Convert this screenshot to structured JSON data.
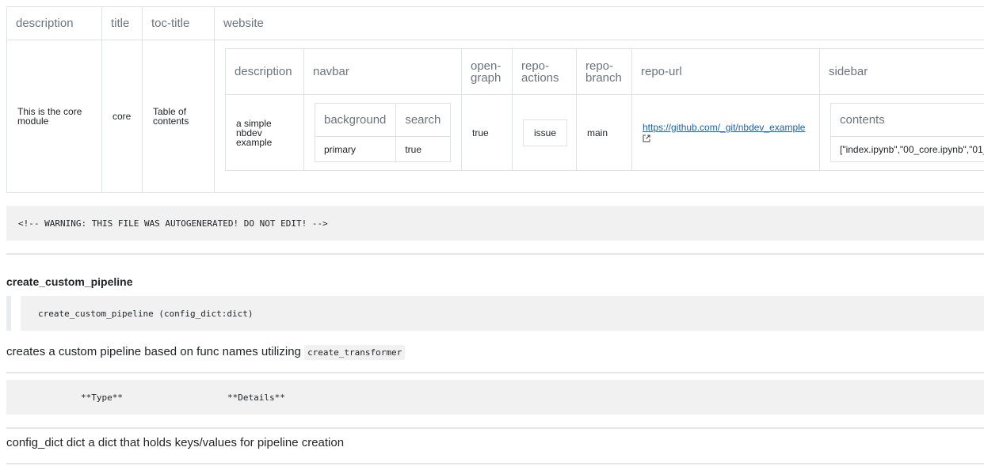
{
  "config_table": {
    "headers": [
      "description",
      "title",
      "toc-title",
      "website"
    ],
    "description": "This is the core module",
    "title": "core",
    "toc_title": "Table of contents",
    "website": {
      "headers": [
        "description",
        "navbar",
        "open-graph",
        "repo-actions",
        "repo-branch",
        "repo-url",
        "sidebar"
      ],
      "description": "a simple nbdev example",
      "navbar": {
        "headers": [
          "background",
          "search"
        ],
        "values": [
          "primary",
          "true"
        ]
      },
      "open_graph": "true",
      "repo_actions": "issue",
      "repo_branch": "main",
      "repo_url": "https://github.com/_git/nbdev_example",
      "sidebar": {
        "header": "contents",
        "value": "[\"index.ipynb\",\"00_core.ipynb\",\"01_"
      }
    }
  },
  "warning_comment": "<!-- WARNING: THIS FILE WAS AUTOGENERATED! DO NOT EDIT! -->",
  "function": {
    "name": "create_custom_pipeline",
    "signature": "create_custom_pipeline (config_dict:dict)",
    "description_prefix": "creates a custom pipeline based on func names utilizing",
    "description_code": "create_transformer",
    "params_header_type": "**Type**",
    "params_header_details": "**Details**",
    "params_row": "config_dict dict a dict that holds keys/values for pipeline creation"
  }
}
